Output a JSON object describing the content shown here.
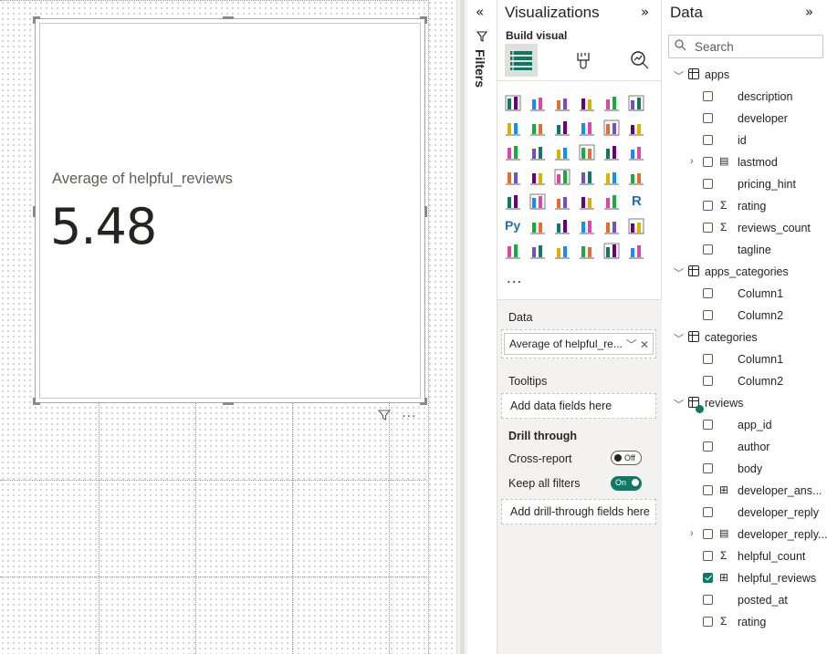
{
  "card": {
    "label": "Average of helpful_reviews",
    "value": "5.48"
  },
  "filters_pane": {
    "label": "Filters",
    "collapse_icon": "double-chevron-left-icon"
  },
  "visualizations": {
    "title": "Visualizations",
    "build_visual_label": "Build visual",
    "more_label": "...",
    "wells": {
      "data_label": "Data",
      "data_field": "Average of helpful_re...",
      "tooltips_label": "Tooltips",
      "tooltips_placeholder": "Add data fields here",
      "drill_label": "Drill through",
      "cross_report_label": "Cross-report",
      "cross_report_state": "Off",
      "keep_filters_label": "Keep all filters",
      "keep_filters_state": "On",
      "drill_placeholder": "Add drill-through fields here"
    }
  },
  "data_pane": {
    "title": "Data",
    "search_placeholder": "Search",
    "tree": [
      {
        "type": "table",
        "label": "apps",
        "expanded": true
      },
      {
        "type": "field",
        "label": "description",
        "checked": false,
        "icon": ""
      },
      {
        "type": "field",
        "label": "developer",
        "checked": false,
        "icon": ""
      },
      {
        "type": "field",
        "label": "id",
        "checked": false,
        "icon": ""
      },
      {
        "type": "field",
        "label": "lastmod",
        "checked": false,
        "icon": "calendar",
        "expandable": true
      },
      {
        "type": "field",
        "label": "pricing_hint",
        "checked": false,
        "icon": ""
      },
      {
        "type": "field",
        "label": "rating",
        "checked": false,
        "icon": "sigma"
      },
      {
        "type": "field",
        "label": "reviews_count",
        "checked": false,
        "icon": "sigma"
      },
      {
        "type": "field",
        "label": "tagline",
        "checked": false,
        "icon": ""
      },
      {
        "type": "table",
        "label": "apps_categories",
        "expanded": true
      },
      {
        "type": "field",
        "label": "Column1",
        "checked": false,
        "icon": ""
      },
      {
        "type": "field",
        "label": "Column2",
        "checked": false,
        "icon": ""
      },
      {
        "type": "table",
        "label": "categories",
        "expanded": true
      },
      {
        "type": "field",
        "label": "Column1",
        "checked": false,
        "icon": ""
      },
      {
        "type": "field",
        "label": "Column2",
        "checked": false,
        "icon": ""
      },
      {
        "type": "table",
        "label": "reviews",
        "expanded": true,
        "active": true
      },
      {
        "type": "field",
        "label": "app_id",
        "checked": false,
        "icon": ""
      },
      {
        "type": "field",
        "label": "author",
        "checked": false,
        "icon": ""
      },
      {
        "type": "field",
        "label": "body",
        "checked": false,
        "icon": ""
      },
      {
        "type": "field",
        "label": "developer_ans...",
        "checked": false,
        "icon": "calc"
      },
      {
        "type": "field",
        "label": "developer_reply",
        "checked": false,
        "icon": ""
      },
      {
        "type": "field",
        "label": "developer_reply...",
        "checked": false,
        "icon": "calendar",
        "expandable": true
      },
      {
        "type": "field",
        "label": "helpful_count",
        "checked": false,
        "icon": "sigma"
      },
      {
        "type": "field",
        "label": "helpful_reviews",
        "checked": true,
        "icon": "calc"
      },
      {
        "type": "field",
        "label": "posted_at",
        "checked": false,
        "icon": ""
      },
      {
        "type": "field",
        "label": "rating",
        "checked": false,
        "icon": "sigma"
      }
    ]
  },
  "colors": {
    "accent": "#117865",
    "pane_bg": "#f3f2f1"
  }
}
